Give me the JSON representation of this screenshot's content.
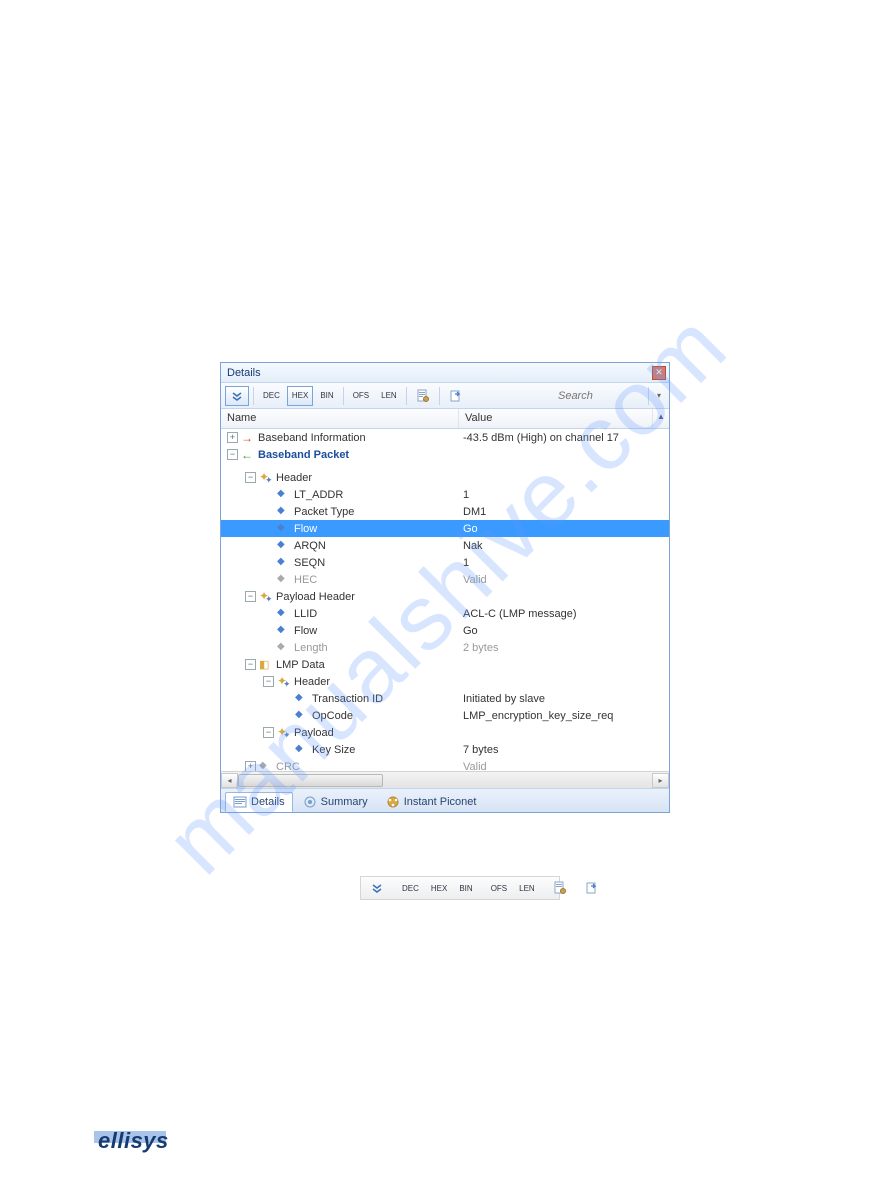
{
  "watermark": "manualshive.com",
  "panel": {
    "title": "Details",
    "search_placeholder": "Search",
    "toolbar": {
      "dec": "DEC",
      "hex": "HEX",
      "bin": "BIN",
      "ofs": "OFS",
      "len": "LEN"
    },
    "columns": {
      "name": "Name",
      "value": "Value"
    },
    "rows": [
      {
        "indent": 0,
        "exp": "+",
        "iconClass": "ico-arrow-r",
        "iconChar": "→",
        "name": "Baseband Information",
        "value": "-43.5 dBm (High) on channel 17"
      },
      {
        "indent": 0,
        "exp": "−",
        "iconClass": "ico-arrow-g",
        "iconChar": "←",
        "name": "Baseband Packet",
        "value": "",
        "style": "bold-blue"
      },
      {
        "indent": 0,
        "exp": "",
        "name": "",
        "value": "",
        "spacer": true
      },
      {
        "indent": 1,
        "exp": "−",
        "iconClass": "ico-gears",
        "iconChar": "",
        "name": "Header",
        "value": ""
      },
      {
        "indent": 2,
        "exp": "",
        "iconClass": "ico-diamond",
        "iconChar": "◆",
        "name": "LT_ADDR",
        "value": "1"
      },
      {
        "indent": 2,
        "exp": "",
        "iconClass": "ico-diamond",
        "iconChar": "◆",
        "name": "Packet Type",
        "value": "DM1"
      },
      {
        "indent": 2,
        "exp": "",
        "iconClass": "ico-diamond",
        "iconChar": "◆",
        "name": "Flow",
        "value": "Go",
        "selected": true
      },
      {
        "indent": 2,
        "exp": "",
        "iconClass": "ico-diamond",
        "iconChar": "◆",
        "name": "ARQN",
        "value": "Nak"
      },
      {
        "indent": 2,
        "exp": "",
        "iconClass": "ico-diamond",
        "iconChar": "◆",
        "name": "SEQN",
        "value": "1"
      },
      {
        "indent": 2,
        "exp": "",
        "iconClass": "ico-diamond-g",
        "iconChar": "◆",
        "name": "HEC",
        "value": "Valid",
        "grey": true
      },
      {
        "indent": 1,
        "exp": "−",
        "iconClass": "ico-gears",
        "iconChar": "",
        "name": "Payload Header",
        "value": ""
      },
      {
        "indent": 2,
        "exp": "",
        "iconClass": "ico-diamond",
        "iconChar": "◆",
        "name": "LLID",
        "value": "ACL-C (LMP message)"
      },
      {
        "indent": 2,
        "exp": "",
        "iconClass": "ico-diamond",
        "iconChar": "◆",
        "name": "Flow",
        "value": "Go"
      },
      {
        "indent": 2,
        "exp": "",
        "iconClass": "ico-diamond-g",
        "iconChar": "◆",
        "name": "Length",
        "value": "2 bytes",
        "grey": true
      },
      {
        "indent": 1,
        "exp": "−",
        "iconClass": "ico-cube",
        "iconChar": "◧",
        "name": "LMP Data",
        "value": ""
      },
      {
        "indent": 2,
        "exp": "−",
        "iconClass": "ico-gears",
        "iconChar": "",
        "name": "Header",
        "value": ""
      },
      {
        "indent": 3,
        "exp": "",
        "iconClass": "ico-diamond",
        "iconChar": "◆",
        "name": "Transaction ID",
        "value": "Initiated by slave"
      },
      {
        "indent": 3,
        "exp": "",
        "iconClass": "ico-diamond",
        "iconChar": "◆",
        "name": "OpCode",
        "value": "LMP_encryption_key_size_req"
      },
      {
        "indent": 2,
        "exp": "−",
        "iconClass": "ico-gears",
        "iconChar": "",
        "name": "Payload",
        "value": ""
      },
      {
        "indent": 3,
        "exp": "",
        "iconClass": "ico-diamond",
        "iconChar": "◆",
        "name": "Key Size",
        "value": "7 bytes"
      },
      {
        "indent": 1,
        "exp": "+",
        "iconClass": "ico-diamond-g",
        "iconChar": "◆",
        "name": "CRC",
        "value": "Valid",
        "grey": true
      }
    ],
    "tabs": {
      "details": "Details",
      "summary": "Summary",
      "piconet": "Instant Piconet"
    }
  },
  "toolbar2": {
    "dec": "DEC",
    "hex": "HEX",
    "bin": "BIN",
    "ofs": "OFS",
    "len": "LEN"
  },
  "logo": "ellisys"
}
